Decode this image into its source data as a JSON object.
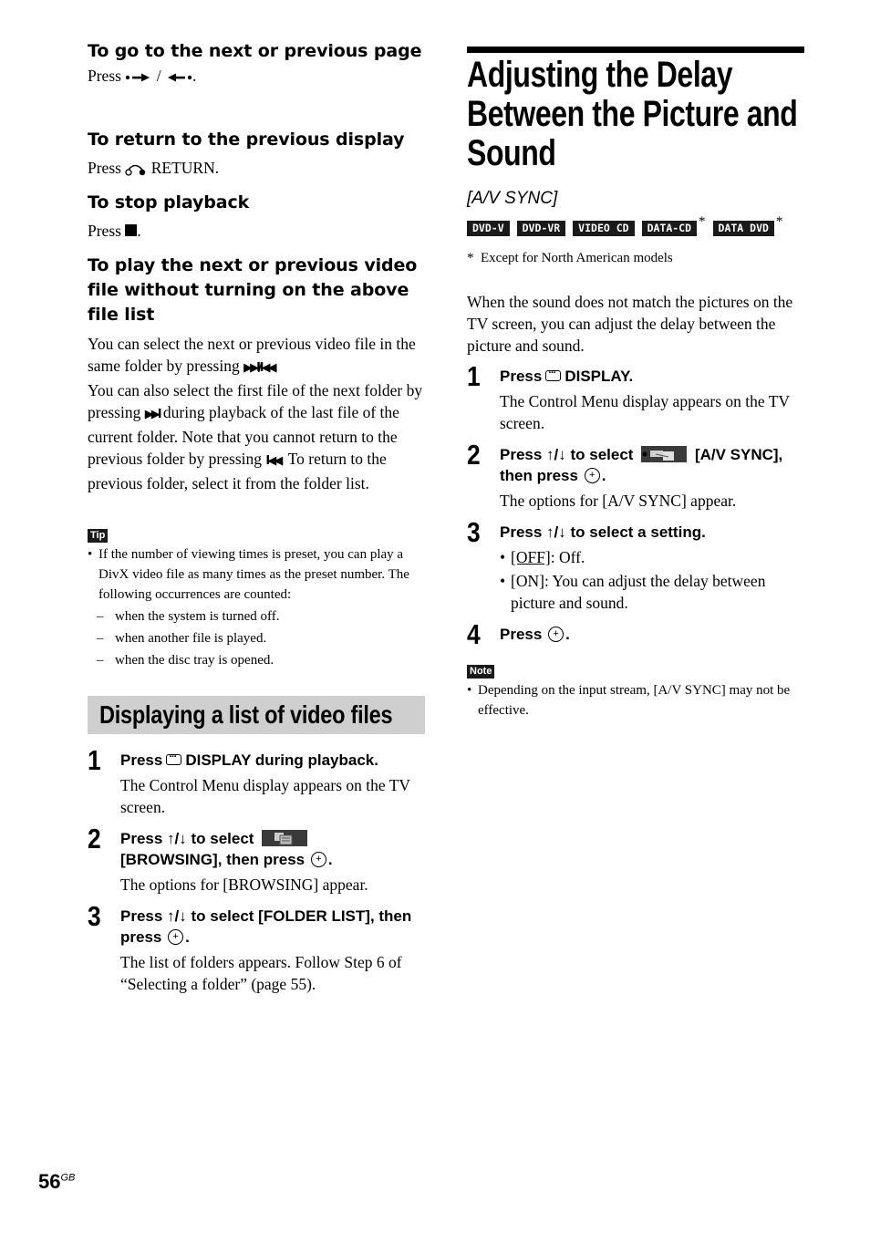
{
  "left": {
    "next_prev_page": {
      "heading": "To go to the next or previous page",
      "press": "Press",
      "sep": "/",
      "end": "."
    },
    "return": {
      "heading": "To return to the previous display",
      "press": "Press",
      "label": "RETURN."
    },
    "stop": {
      "heading": "To stop playback",
      "press": "Press",
      "end": "."
    },
    "next_prev_video": {
      "heading": "To play the next or previous video file without turning on the above file list",
      "p1a": "You can select the next or previous video file in the same folder by pressing",
      "p1_icon": "▶▶I/I◀◀",
      "p1b": ".",
      "p2a": "You can also select the first file of the next folder by pressing",
      "p2_icon": "▶▶I",
      "p2b": "during playback of the last file of the current folder. Note that you cannot return to the previous folder by pressing",
      "p2_icon2": "I◀◀",
      "p2c": ". To return to the previous folder, select it from the folder list."
    },
    "tip": {
      "label": "Tip",
      "text": "If the number of viewing times is preset, you can play a DivX video file as many times as the preset number. The following occurrences are counted:",
      "items": [
        "when the system is turned off.",
        "when another file is played.",
        "when the disc tray is opened."
      ]
    },
    "section": {
      "title": "Displaying a list of video files",
      "steps": [
        {
          "num": "1",
          "title_a": "Press",
          "title_b": "DISPLAY during playback.",
          "body": "The Control Menu display appears on the TV screen."
        },
        {
          "num": "2",
          "title_a": "Press ↑/↓ to select",
          "title_b": "[BROWSING], then press",
          "title_c": ".",
          "body": "The options for [BROWSING] appear."
        },
        {
          "num": "3",
          "title_a": "Press ↑/↓ to select [FOLDER LIST], then press",
          "title_c": ".",
          "body": "The list of folders appears. Follow Step 6 of “Selecting a folder” (page 55)."
        }
      ]
    }
  },
  "right": {
    "title": "Adjusting the Delay Between the Picture and Sound",
    "subtitle": "[A/V SYNC]",
    "discs": [
      "DVD-V",
      "DVD-VR",
      "VIDEO CD",
      "DATA-CD",
      "DATA DVD"
    ],
    "disc_star": "*",
    "footnote": "*  Except for North American models",
    "intro": "When the sound does not match the pictures on the TV screen, you can adjust the delay between the picture and sound.",
    "steps": [
      {
        "num": "1",
        "title_a": "Press",
        "title_b": "DISPLAY.",
        "body": "The Control Menu display appears on the TV screen."
      },
      {
        "num": "2",
        "title_a": "Press ↑/↓ to select",
        "title_b": "[A/V SYNC], then press",
        "title_c": ".",
        "body": "The options for [A/V SYNC] appear."
      },
      {
        "num": "3",
        "title_a": "Press ↑/↓ to select a setting.",
        "options": [
          {
            "key": "[OFF]",
            "desc": ": Off."
          },
          {
            "key": "[ON]",
            "desc": ": You can adjust the delay between picture and sound."
          }
        ]
      },
      {
        "num": "4",
        "title_a": "Press",
        "title_c": "."
      }
    ],
    "note": {
      "label": "Note",
      "text": "Depending on the input stream, [A/V SYNC] may not be effective."
    }
  },
  "footer": {
    "page": "56",
    "suffix": "GB"
  }
}
